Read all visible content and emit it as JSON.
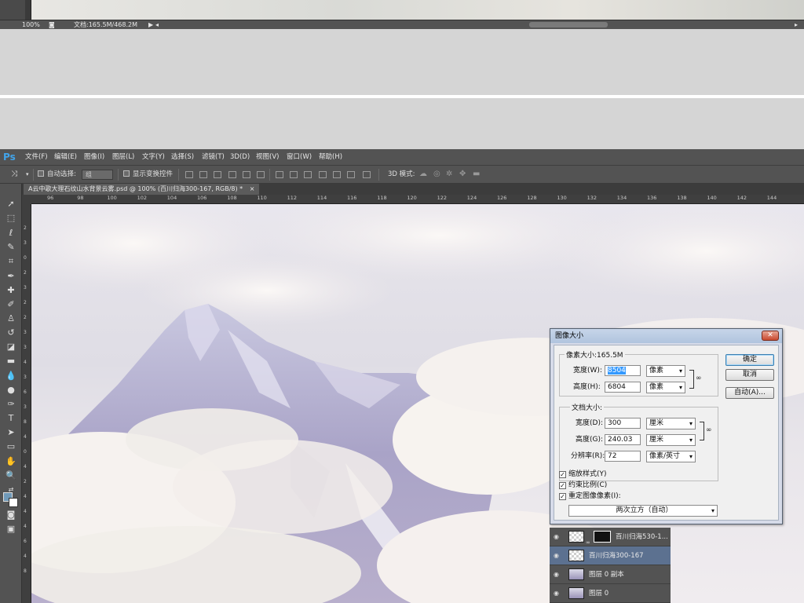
{
  "top_status": {
    "zoom": "100%",
    "doc_info": "文档:165.5M/468.2M"
  },
  "app": {
    "logo": "Ps",
    "menu": [
      "文件(F)",
      "编辑(E)",
      "图像(I)",
      "图层(L)",
      "文字(Y)",
      "选择(S)",
      "滤镜(T)",
      "3D(D)",
      "视图(V)",
      "窗口(W)",
      "帮助(H)"
    ]
  },
  "options_bar": {
    "auto_select_label": "自动选择:",
    "auto_select_value": "组",
    "show_transform_label": "显示变换控件",
    "mode_3d_label": "3D 模式:"
  },
  "document": {
    "tab_title": "A云中歌大理石纹山水背景云雾.psd @ 100% (百川归海300-167, RGB/8) *",
    "tab_close": "×"
  },
  "ruler": {
    "h_ticks": [
      "96",
      "98",
      "100",
      "102",
      "104",
      "106",
      "108",
      "110",
      "112",
      "114",
      "116",
      "118",
      "120",
      "122",
      "124",
      "126",
      "128",
      "130",
      "132",
      "134",
      "136",
      "138",
      "140",
      "142",
      "144"
    ],
    "v_ticks": [
      "2",
      "3",
      "0",
      "2",
      "3",
      "2",
      "2",
      "3",
      "3",
      "4",
      "3",
      "6",
      "3",
      "8",
      "4",
      "0",
      "4",
      "2",
      "4",
      "4",
      "4",
      "6",
      "4",
      "8"
    ]
  },
  "dialog": {
    "title": "图像大小",
    "close": "✕",
    "pixel_dims_label": "像素大小:165.5M",
    "width_label": "宽度(W):",
    "width_value": "8504",
    "width_unit": "像素",
    "height_label": "高度(H):",
    "height_value": "6804",
    "height_unit": "像素",
    "doc_size_label": "文档大小:",
    "doc_width_label": "宽度(D):",
    "doc_width_value": "300",
    "doc_width_unit": "厘米",
    "doc_height_label": "高度(G):",
    "doc_height_value": "240.03",
    "doc_height_unit": "厘米",
    "resolution_label": "分辨率(R):",
    "resolution_value": "72",
    "resolution_unit": "像素/英寸",
    "scale_styles": "缩放样式(Y)",
    "constrain": "约束比例(C)",
    "resample": "重定图像像素(I):",
    "resample_method": "两次立方（自动）",
    "ok": "确定",
    "cancel": "取消",
    "auto": "自动(A)..."
  },
  "layers": [
    {
      "name": "百川归海530-1...",
      "active": false
    },
    {
      "name": "百川归海300-167",
      "active": true
    },
    {
      "name": "图层 0 副本",
      "active": false
    },
    {
      "name": "图层 0",
      "active": false
    }
  ],
  "colors": {
    "ui_dark": "#535353",
    "selection": "#3399ff",
    "ps_blue": "#41a4ea"
  }
}
